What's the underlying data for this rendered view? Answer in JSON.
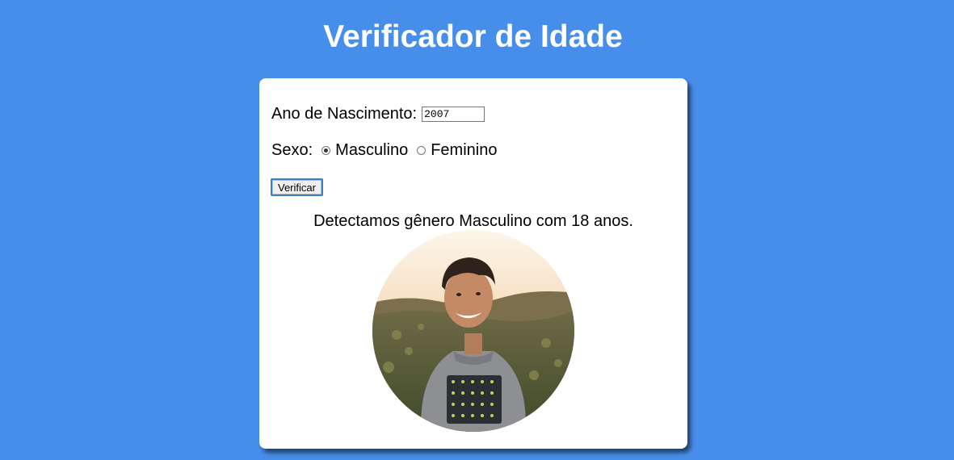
{
  "page": {
    "title": "Verificador de Idade"
  },
  "form": {
    "year_label": "Ano de Nascimento:",
    "year_value": "2007",
    "sex_label": "Sexo:",
    "options": [
      {
        "label": "Masculino",
        "checked": true
      },
      {
        "label": "Feminino",
        "checked": false
      }
    ],
    "button_label": "Verificar"
  },
  "result": {
    "message": "Detectamos gênero Masculino com 18 anos."
  },
  "colors": {
    "background": "#478eeb",
    "card": "#ffffff"
  }
}
